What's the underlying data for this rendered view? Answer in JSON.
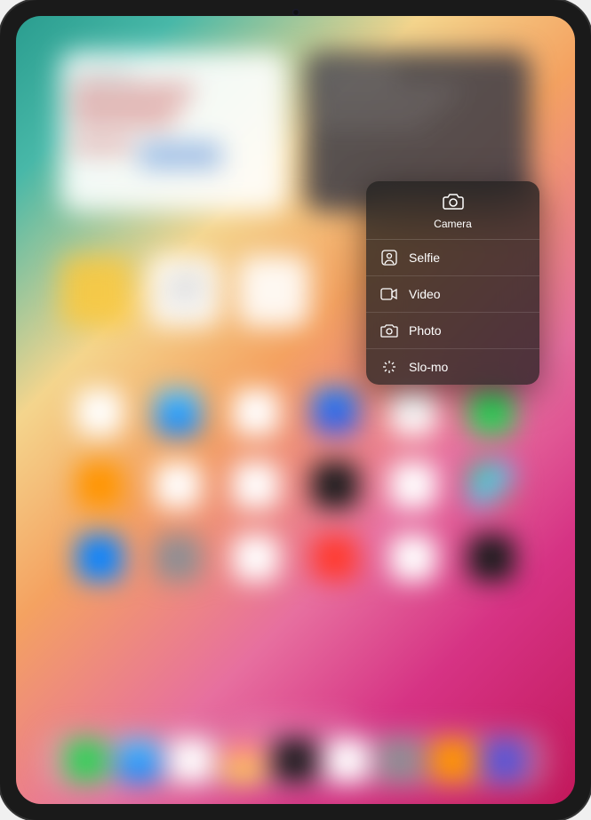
{
  "context_menu": {
    "title": "Camera",
    "items": [
      {
        "icon": "person-square-icon",
        "label": "Selfie"
      },
      {
        "icon": "video-icon",
        "label": "Video"
      },
      {
        "icon": "camera-icon",
        "label": "Photo"
      },
      {
        "icon": "burst-icon",
        "label": "Slo-mo"
      }
    ]
  },
  "colors": {
    "menu_bg": "rgba(30,30,30,0.75)",
    "menu_text": "#ffffff"
  }
}
